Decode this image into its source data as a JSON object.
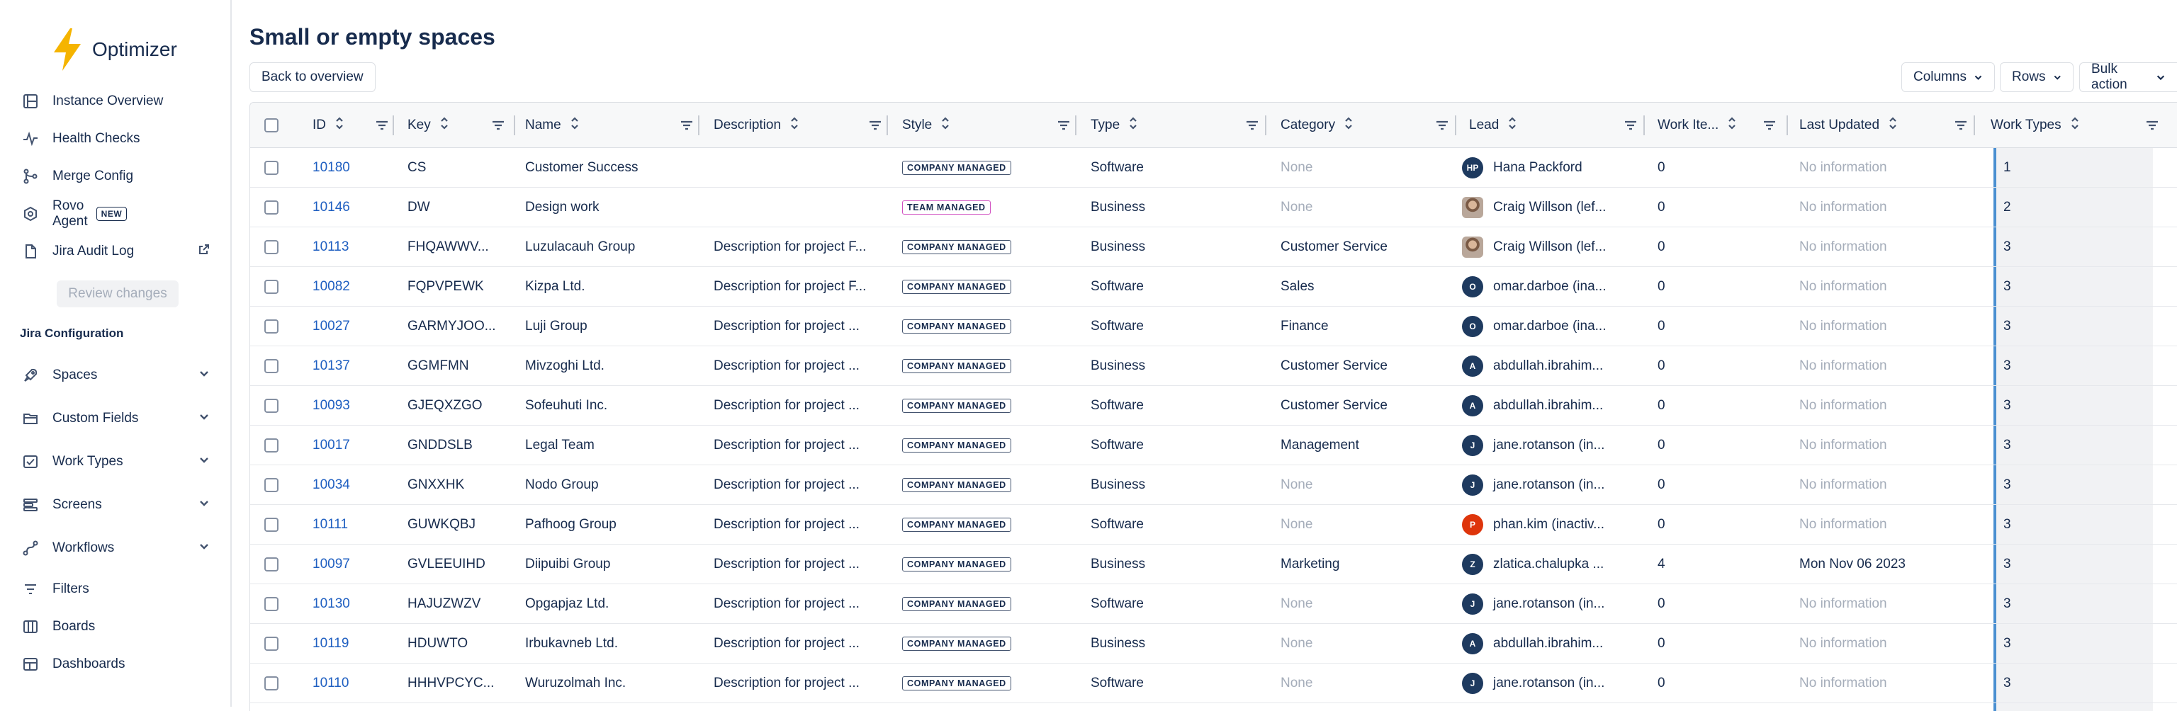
{
  "app": {
    "name": "Optimizer"
  },
  "sidebar": {
    "items": [
      {
        "label": "Instance Overview",
        "icon": "list-box-icon"
      },
      {
        "label": "Health Checks",
        "icon": "pulse-icon"
      },
      {
        "label": "Merge Config",
        "icon": "merge-icon"
      },
      {
        "label": "Rovo Agent",
        "icon": "rovo-icon",
        "badge": "NEW"
      },
      {
        "label": "Jira Audit Log",
        "icon": "document-icon"
      }
    ],
    "review_label": "Review changes",
    "section_title": "Jira Configuration",
    "config_items": [
      {
        "label": "Spaces",
        "icon": "rocket-icon"
      },
      {
        "label": "Custom Fields",
        "icon": "folder-icon"
      },
      {
        "label": "Work Types",
        "icon": "checkbox-icon"
      },
      {
        "label": "Screens",
        "icon": "layers-icon"
      },
      {
        "label": "Workflows",
        "icon": "workflow-icon"
      }
    ],
    "other_items": [
      {
        "label": "Filters",
        "icon": "filter-icon"
      },
      {
        "label": "Boards",
        "icon": "board-icon"
      },
      {
        "label": "Dashboards",
        "icon": "dashboard-icon"
      }
    ]
  },
  "page": {
    "title": "Small or empty spaces",
    "back_label": "Back to overview",
    "columns_label": "Columns",
    "rows_label": "Rows",
    "bulk_label": "Bulk action"
  },
  "table": {
    "headers": {
      "id": "ID",
      "key": "Key",
      "name": "Name",
      "description": "Description",
      "style": "Style",
      "type": "Type",
      "category": "Category",
      "lead": "Lead",
      "work_items": "Work Ite...",
      "last_updated": "Last Updated",
      "work_types": "Work Types"
    },
    "rows": [
      {
        "id": "10180",
        "key": "CS",
        "name": "Customer Success",
        "description": "",
        "style": "COMPANY MANAGED",
        "type": "Software",
        "category": "None",
        "lead": "Hana Packford",
        "lead_initials": "HP",
        "work_items": "0",
        "last_updated": "No information",
        "work_types": "1"
      },
      {
        "id": "10146",
        "key": "DW",
        "name": "Design work",
        "description": "",
        "style": "TEAM MANAGED",
        "type": "Business",
        "category": "None",
        "lead": "Craig Willson (lef...",
        "lead_initials": "",
        "work_items": "0",
        "last_updated": "No information",
        "work_types": "2"
      },
      {
        "id": "10113",
        "key": "FHQAWWV...",
        "name": "Luzulacauh Group",
        "description": "Description for project F...",
        "style": "COMPANY MANAGED",
        "type": "Business",
        "category": "Customer Service",
        "lead": "Craig Willson (lef...",
        "lead_initials": "",
        "work_items": "0",
        "last_updated": "No information",
        "work_types": "3"
      },
      {
        "id": "10082",
        "key": "FQPVPEWK",
        "name": "Kizpa Ltd.",
        "description": "Description for project F...",
        "style": "COMPANY MANAGED",
        "type": "Software",
        "category": "Sales",
        "lead": "omar.darboe (ina...",
        "lead_initials": "O",
        "work_items": "0",
        "last_updated": "No information",
        "work_types": "3"
      },
      {
        "id": "10027",
        "key": "GARMYJOO...",
        "name": "Luji Group",
        "description": "Description for project ...",
        "style": "COMPANY MANAGED",
        "type": "Software",
        "category": "Finance",
        "lead": "omar.darboe (ina...",
        "lead_initials": "O",
        "work_items": "0",
        "last_updated": "No information",
        "work_types": "3"
      },
      {
        "id": "10137",
        "key": "GGMFMN",
        "name": "Mivzoghi Ltd.",
        "description": "Description for project ...",
        "style": "COMPANY MANAGED",
        "type": "Business",
        "category": "Customer Service",
        "lead": "abdullah.ibrahim...",
        "lead_initials": "A",
        "work_items": "0",
        "last_updated": "No information",
        "work_types": "3"
      },
      {
        "id": "10093",
        "key": "GJEQXZGO",
        "name": "Sofeuhuti Inc.",
        "description": "Description for project ...",
        "style": "COMPANY MANAGED",
        "type": "Software",
        "category": "Customer Service",
        "lead": "abdullah.ibrahim...",
        "lead_initials": "A",
        "work_items": "0",
        "last_updated": "No information",
        "work_types": "3"
      },
      {
        "id": "10017",
        "key": "GNDDSLB",
        "name": "Legal Team",
        "description": "Description for project ...",
        "style": "COMPANY MANAGED",
        "type": "Software",
        "category": "Management",
        "lead": "jane.rotanson (in...",
        "lead_initials": "J",
        "work_items": "0",
        "last_updated": "No information",
        "work_types": "3"
      },
      {
        "id": "10034",
        "key": "GNXXHK",
        "name": "Nodo Group",
        "description": "Description for project ...",
        "style": "COMPANY MANAGED",
        "type": "Business",
        "category": "None",
        "lead": "jane.rotanson (in...",
        "lead_initials": "J",
        "work_items": "0",
        "last_updated": "No information",
        "work_types": "3"
      },
      {
        "id": "10111",
        "key": "GUWKQBJ",
        "name": "Pafhoog Group",
        "description": "Description for project ...",
        "style": "COMPANY MANAGED",
        "type": "Software",
        "category": "None",
        "lead": "phan.kim (inactiv...",
        "lead_initials": "P",
        "work_items": "0",
        "last_updated": "No information",
        "work_types": "3"
      },
      {
        "id": "10097",
        "key": "GVLEEUIHD",
        "name": "Diipuibi Group",
        "description": "Description for project ...",
        "style": "COMPANY MANAGED",
        "type": "Business",
        "category": "Marketing",
        "lead": "zlatica.chalupka ...",
        "lead_initials": "Z",
        "work_items": "4",
        "last_updated": "Mon Nov 06 2023",
        "work_types": "3"
      },
      {
        "id": "10130",
        "key": "HAJUZWZV",
        "name": "Opgapjaz Ltd.",
        "description": "Description for project ...",
        "style": "COMPANY MANAGED",
        "type": "Software",
        "category": "None",
        "lead": "jane.rotanson (in...",
        "lead_initials": "J",
        "work_items": "0",
        "last_updated": "No information",
        "work_types": "3"
      },
      {
        "id": "10119",
        "key": "HDUWTO",
        "name": "Irbukavneb Ltd.",
        "description": "Description for project ...",
        "style": "COMPANY MANAGED",
        "type": "Business",
        "category": "None",
        "lead": "abdullah.ibrahim...",
        "lead_initials": "A",
        "work_items": "0",
        "last_updated": "No information",
        "work_types": "3"
      },
      {
        "id": "10110",
        "key": "HHHVPCYC...",
        "name": "Wuruzolmah Inc.",
        "description": "Description for project ...",
        "style": "COMPANY MANAGED",
        "type": "Software",
        "category": "None",
        "lead": "jane.rotanson (in...",
        "lead_initials": "J",
        "work_items": "0",
        "last_updated": "No information",
        "work_types": "3"
      }
    ]
  },
  "colors": {
    "link": "#1f5fc1",
    "accent_bar": "#4a8fd1",
    "brand_bolt": "#f5b400",
    "team_lozenge": "#d04fc0"
  }
}
